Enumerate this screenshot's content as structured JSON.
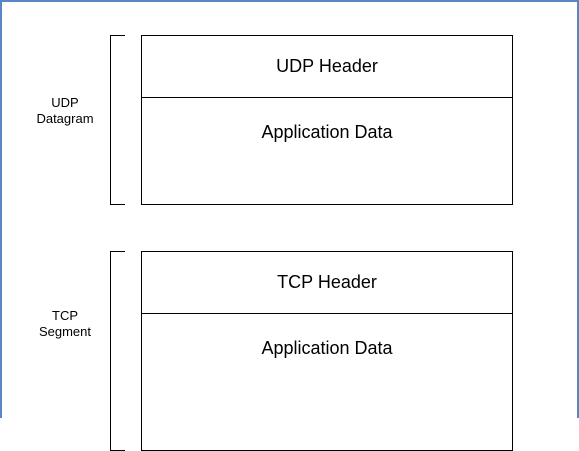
{
  "diagram": {
    "udp": {
      "label": "UDP\nDatagram",
      "header": "UDP Header",
      "body": "Application Data"
    },
    "tcp": {
      "label": "TCP\nSegment",
      "header": "TCP Header",
      "body": "Application Data"
    }
  }
}
